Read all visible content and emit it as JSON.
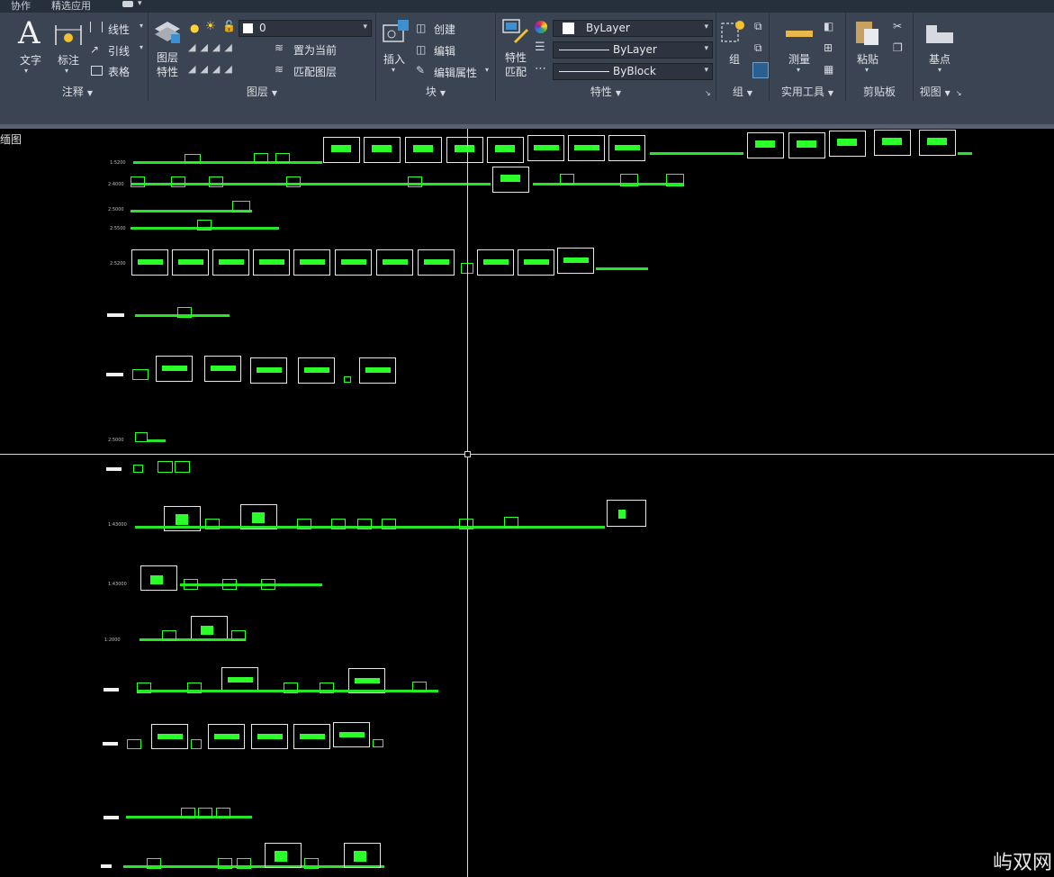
{
  "tabs": {
    "collab": "协作",
    "featured": "精选应用"
  },
  "annotation": {
    "text": "文字",
    "dimension": "标注",
    "linear": "线性",
    "leader": "引线",
    "table": "表格",
    "title": "注释"
  },
  "layers": {
    "properties": "图层\n特性",
    "current_layer": "0",
    "make_current": "置为当前",
    "match_layer": "匹配图层",
    "title": "图层"
  },
  "block": {
    "insert": "插入",
    "create": "创建",
    "edit": "编辑",
    "edit_attr": "编辑属性",
    "title": "块"
  },
  "properties": {
    "match": "特性\n匹配",
    "color": "ByLayer",
    "linetype": "ByLayer",
    "lineweight": "ByBlock",
    "title": "特性"
  },
  "groups": {
    "group": "组",
    "title": "组"
  },
  "utilities": {
    "measure": "测量",
    "title": "实用工具"
  },
  "clipboard": {
    "paste": "粘贴",
    "title": "剪贴板"
  },
  "view": {
    "base": "基点",
    "title": "视图"
  },
  "canvas": {
    "caption": "缅图"
  },
  "watermark": "屿双网",
  "colors": {
    "ribbon": "#3b4453",
    "canvas": "#000000",
    "entity_green": "#2aff2a",
    "crosshair": "#d8d8d8"
  }
}
